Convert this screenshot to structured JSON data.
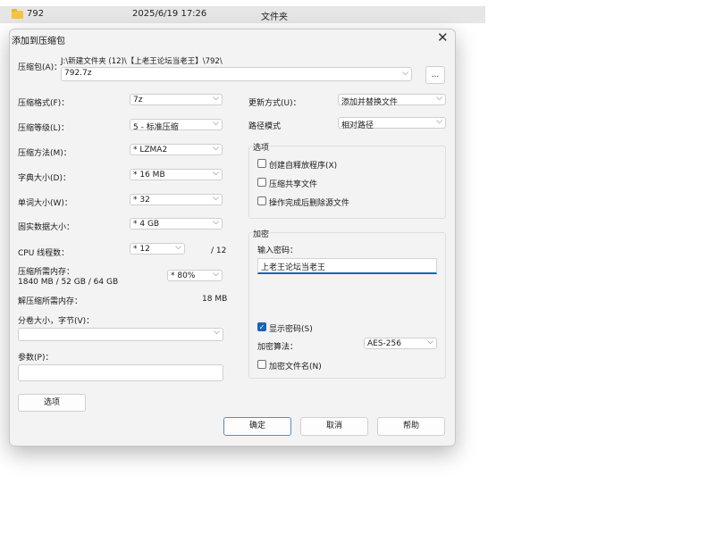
{
  "explorer": {
    "name": "792",
    "date": "2025/6/19 17:26",
    "type": "文件夹"
  },
  "dialog": {
    "title": "添加到压缩包",
    "archive_label": "压缩包(A)：",
    "archive_path": "J:\\新建文件夹 (12)\\【上老王论坛当老王】\\792\\",
    "archive_name": "792.7z",
    "browse_label": "...",
    "left": [
      {
        "label": "压缩格式(F)：",
        "value": "7z"
      },
      {
        "label": "压缩等级(L)：",
        "value": "5 - 标准压缩"
      },
      {
        "label": "压缩方法(M)：",
        "value": "* LZMA2"
      },
      {
        "label": "字典大小(D)：",
        "value": "* 16 MB"
      },
      {
        "label": "单词大小(W)：",
        "value": "* 32"
      },
      {
        "label": "固实数据大小：",
        "value": "* 4 GB"
      },
      {
        "label": "CPU 线程数：",
        "value": "* 12"
      }
    ],
    "cpu_total": "/ 12",
    "mem_label": "压缩所需内存：",
    "mem_value": "1840 MB / 52 GB / 64 GB",
    "mem_percent": "* 80%",
    "decomp_label": "解压缩所需内存：",
    "decomp_value": "18 MB",
    "volume_label": "分卷大小，字节(V)：",
    "volume_value": "",
    "params_label": "参数(P)：",
    "params_value": "",
    "options_button": "选项",
    "update_label": "更新方式(U)：",
    "update_value": "添加并替换文件",
    "path_label": "路径模式",
    "path_value": "相对路径",
    "options_group": "选项",
    "checkboxes": [
      {
        "label": "创建自释放程序(X)",
        "checked": false
      },
      {
        "label": "压缩共享文件",
        "checked": false
      },
      {
        "label": "操作完成后删除源文件",
        "checked": false
      }
    ],
    "encryption_group": "加密",
    "password_label": "输入密码：",
    "password_value": "上老王论坛当老王",
    "show_password": {
      "label": "显示密码(S)",
      "checked": true
    },
    "algo_label": "加密算法：",
    "algo_value": "AES-256",
    "encrypt_names": {
      "label": "加密文件名(N)",
      "checked": false
    },
    "ok_button": "确定",
    "cancel_button": "取消",
    "help_button": "帮助"
  }
}
